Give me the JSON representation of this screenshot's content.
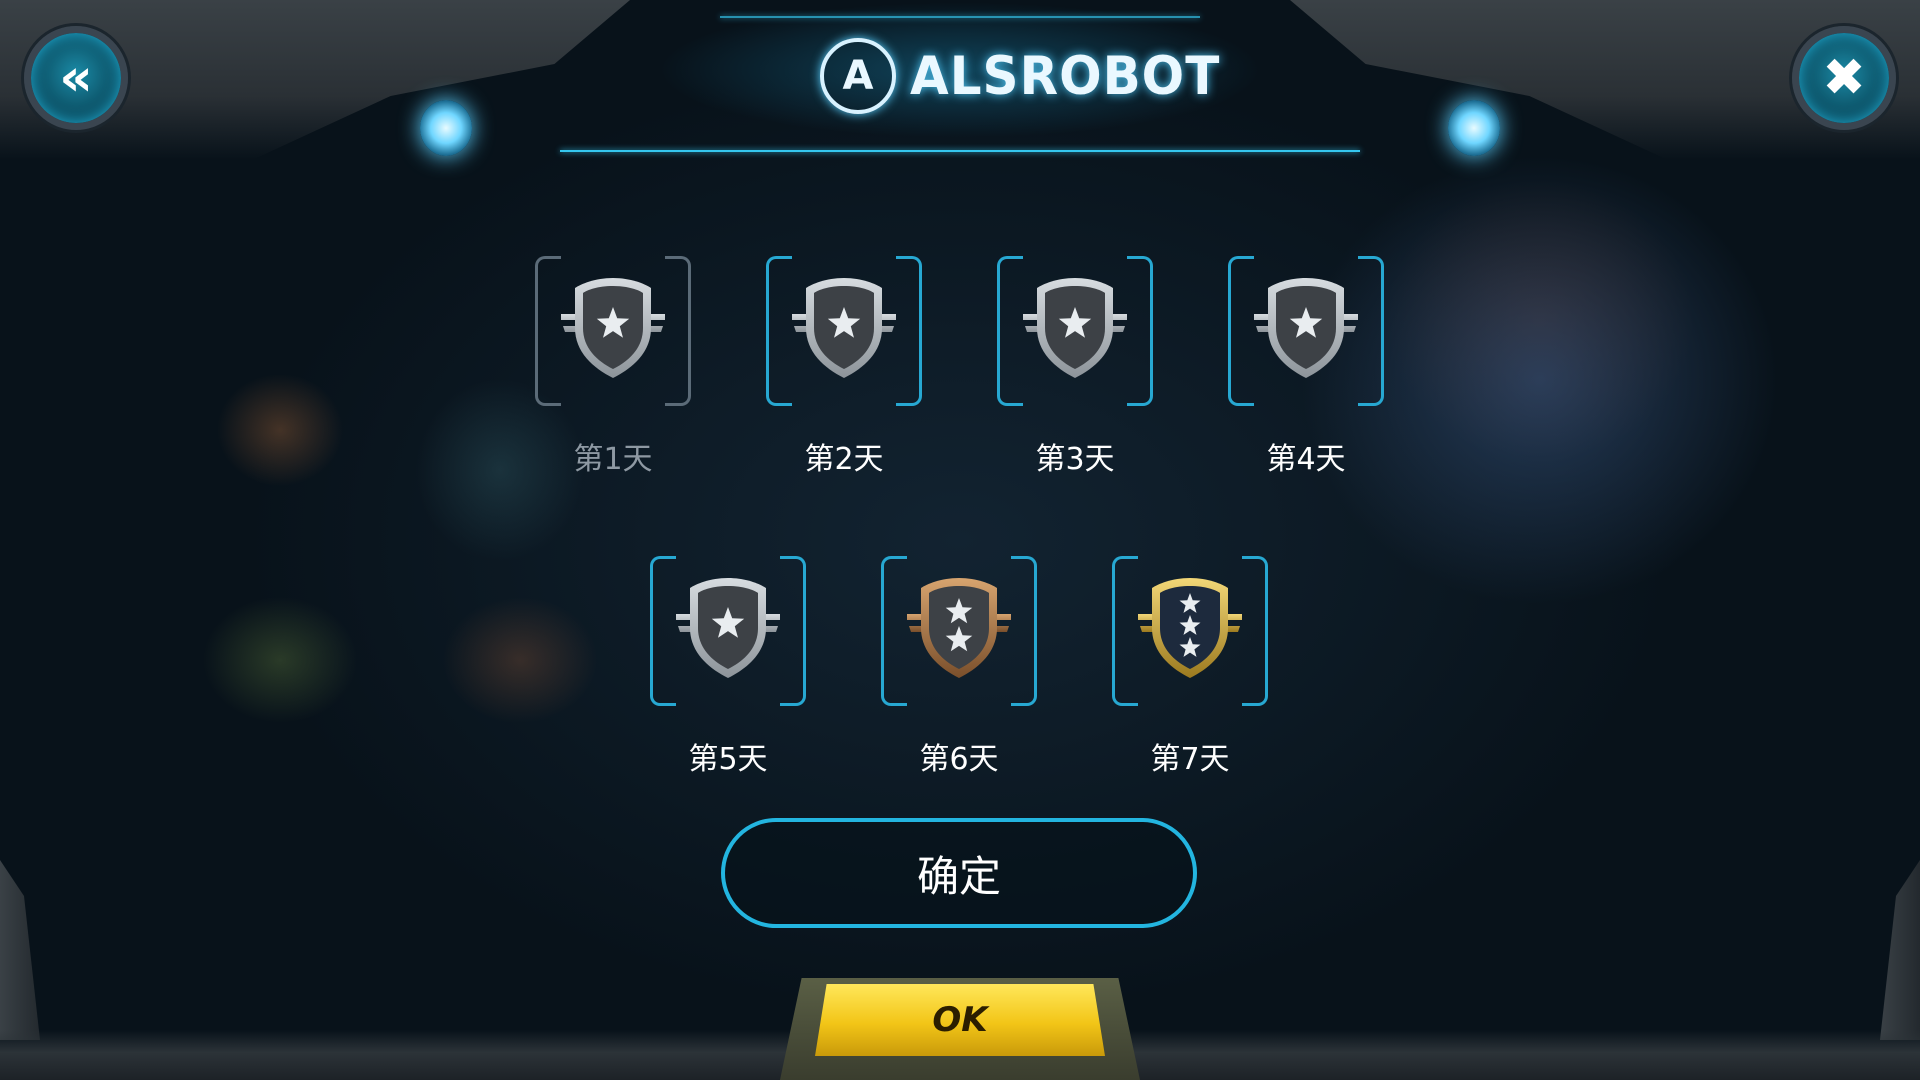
{
  "header": {
    "brand_logo": "A",
    "brand_text": "ALSROBOT",
    "back_button": {
      "icon": "double-chevron-left-icon",
      "glyph": "«"
    },
    "settings_button": {
      "icon": "tools-icon",
      "glyph": "✖"
    }
  },
  "checkin": {
    "days": [
      {
        "label": "第1天",
        "tier": "silver",
        "stars": 1,
        "claimed": true
      },
      {
        "label": "第2天",
        "tier": "silver",
        "stars": 1,
        "claimed": false
      },
      {
        "label": "第3天",
        "tier": "silver",
        "stars": 1,
        "claimed": false
      },
      {
        "label": "第4天",
        "tier": "silver",
        "stars": 1,
        "claimed": false
      },
      {
        "label": "第5天",
        "tier": "silver",
        "stars": 1,
        "claimed": false
      },
      {
        "label": "第6天",
        "tier": "bronze",
        "stars": 2,
        "claimed": false
      },
      {
        "label": "第7天",
        "tier": "gold",
        "stars": 3,
        "claimed": false
      }
    ]
  },
  "confirm_button": {
    "label": "确定"
  },
  "ok_button": {
    "label": "OK"
  },
  "colors": {
    "accent": "#23b5e0",
    "ok": "#f2c517",
    "silver": "#c9ced3",
    "bronze": "#b98457",
    "gold": "#d9b34a"
  }
}
